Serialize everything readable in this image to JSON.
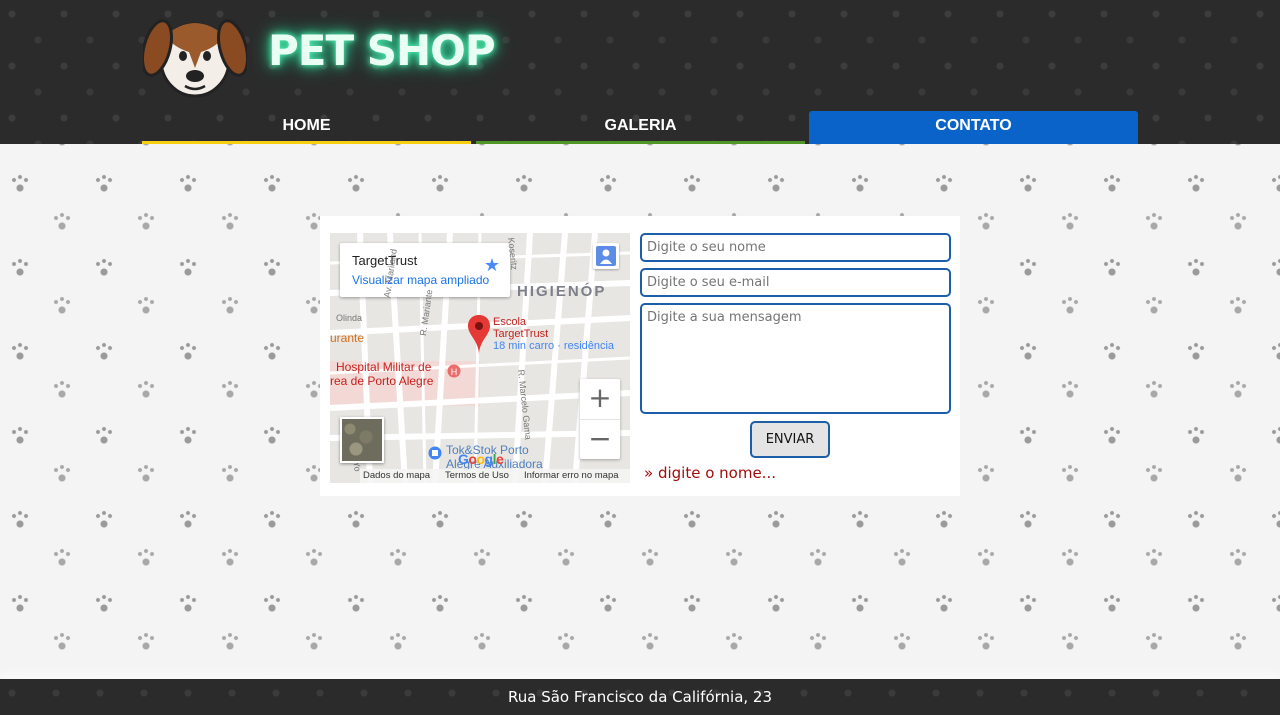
{
  "header": {
    "brand": "PET SHOP",
    "logo_icon": "dog-face-icon",
    "nav": {
      "home": "HOME",
      "galeria": "GALERIA",
      "contato": "CONTATO",
      "active": "CONTATO"
    }
  },
  "map": {
    "card_title": "TargetTrust",
    "card_link": "Visualizar mapa ampliado",
    "area_label": "HIGIENÓP",
    "poi": [
      "Escola",
      "TargetTrust",
      "18 min carro · residência"
    ],
    "hospital": [
      "Hospital Militar de",
      "rea de Porto Alegre"
    ],
    "place_partial": "urante",
    "store": [
      "Tok&Stok Porto",
      "Alegre Auxiliadora"
    ],
    "streets": [
      "Av. Mariland",
      "R. Mariante",
      "Olinda",
      "R. Marcelo Gama",
      "Koseritz",
      "Av. Nova Yo"
    ],
    "zoom_in": "+",
    "zoom_out": "−",
    "footer": {
      "map_data": "Dados do mapa",
      "terms": "Termos de Uso",
      "report": "Informar erro no mapa"
    }
  },
  "form": {
    "name_placeholder": "Digite o seu nome",
    "email_placeholder": "Digite o seu e-mail",
    "message_placeholder": "Digite a sua mensagem",
    "send_label": "ENVIAR",
    "error": "» digite o nome..."
  },
  "footer": {
    "address": "Rua São Francisco da Califórnia, 23"
  },
  "colors": {
    "header_bg": "#2b2b2b",
    "nav_home_underline": "#f5cf10",
    "nav_galeria_underline": "#4f9626",
    "nav_active_bg": "#0a63c9",
    "field_border": "#1c5ea8",
    "error_text": "#a30d0d",
    "brand_glow": "#58f5b5"
  }
}
